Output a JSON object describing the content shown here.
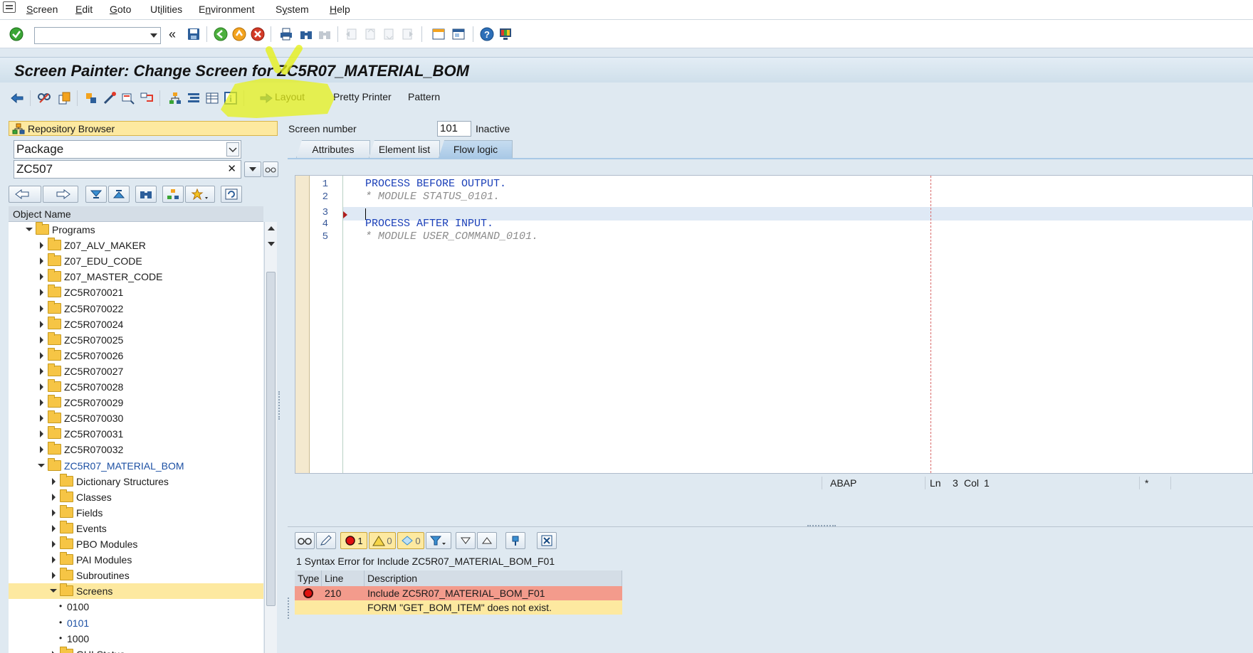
{
  "menu": [
    "Screen",
    "Edit",
    "Goto",
    "Utilities",
    "Environment",
    "System",
    "Help"
  ],
  "menu_underline": [
    "S",
    "E",
    "G",
    "i",
    "n",
    "y",
    "H"
  ],
  "window": {
    "title": "Screen Painter: Change Screen for ZC5R07_MATERIAL_BOM"
  },
  "command_field": {
    "value": ""
  },
  "app_toolbar": {
    "layout": "Layout",
    "pretty_printer": "Pretty Printer",
    "pattern": "Pattern"
  },
  "repository": {
    "header": "Repository Browser",
    "object_type": "Package",
    "object_name": "ZC507",
    "clear_symbol": "✕",
    "column": "Object Name"
  },
  "tree": [
    {
      "label": "Programs",
      "level": 1,
      "expanded": true,
      "folder": true
    },
    {
      "label": "Z07_ALV_MAKER",
      "level": 2,
      "expanded": false,
      "folder": true
    },
    {
      "label": "Z07_EDU_CODE",
      "level": 2,
      "expanded": false,
      "folder": true
    },
    {
      "label": "Z07_MASTER_CODE",
      "level": 2,
      "expanded": false,
      "folder": true
    },
    {
      "label": "ZC5R070021",
      "level": 2,
      "expanded": false,
      "folder": true
    },
    {
      "label": "ZC5R070022",
      "level": 2,
      "expanded": false,
      "folder": true
    },
    {
      "label": "ZC5R070024",
      "level": 2,
      "expanded": false,
      "folder": true
    },
    {
      "label": "ZC5R070025",
      "level": 2,
      "expanded": false,
      "folder": true
    },
    {
      "label": "ZC5R070026",
      "level": 2,
      "expanded": false,
      "folder": true
    },
    {
      "label": "ZC5R070027",
      "level": 2,
      "expanded": false,
      "folder": true
    },
    {
      "label": "ZC5R070028",
      "level": 2,
      "expanded": false,
      "folder": true
    },
    {
      "label": "ZC5R070029",
      "level": 2,
      "expanded": false,
      "folder": true
    },
    {
      "label": "ZC5R070030",
      "level": 2,
      "expanded": false,
      "folder": true
    },
    {
      "label": "ZC5R070031",
      "level": 2,
      "expanded": false,
      "folder": true
    },
    {
      "label": "ZC5R070032",
      "level": 2,
      "expanded": false,
      "folder": true
    },
    {
      "label": "ZC5R07_MATERIAL_BOM",
      "level": 2,
      "expanded": true,
      "folder": true,
      "blue": true
    },
    {
      "label": "Dictionary Structures",
      "level": 3,
      "expanded": false,
      "folder": true
    },
    {
      "label": "Classes",
      "level": 3,
      "expanded": false,
      "folder": true
    },
    {
      "label": "Fields",
      "level": 3,
      "expanded": false,
      "folder": true
    },
    {
      "label": "Events",
      "level": 3,
      "expanded": false,
      "folder": true
    },
    {
      "label": "PBO Modules",
      "level": 3,
      "expanded": false,
      "folder": true
    },
    {
      "label": "PAI Modules",
      "level": 3,
      "expanded": false,
      "folder": true
    },
    {
      "label": "Subroutines",
      "level": 3,
      "expanded": false,
      "folder": true
    },
    {
      "label": "Screens",
      "level": 3,
      "expanded": true,
      "folder": true,
      "highlight": true
    },
    {
      "label": "0100",
      "level": 4,
      "bullet": true
    },
    {
      "label": "0101",
      "level": 4,
      "bullet": true,
      "blue": true
    },
    {
      "label": "1000",
      "level": 4,
      "bullet": true
    },
    {
      "label": "GUI Status",
      "level": 3,
      "expanded": false,
      "folder": true
    }
  ],
  "screen": {
    "number_label": "Screen number",
    "number": "101",
    "status": "Inactive"
  },
  "tabs": [
    {
      "label": "Attributes",
      "active": false
    },
    {
      "label": "Element list",
      "active": false
    },
    {
      "label": "Flow logic",
      "active": true
    }
  ],
  "editor": {
    "lines": [
      {
        "num": "1",
        "text": "PROCESS BEFORE OUTPUT.",
        "type": "kw"
      },
      {
        "num": "2",
        "text": "* MODULE STATUS_0101.",
        "type": "cm"
      },
      {
        "num": "3",
        "text": "",
        "type": "kw"
      },
      {
        "num": "4",
        "text": "PROCESS AFTER INPUT.",
        "type": "kw"
      },
      {
        "num": "5",
        "text": "* MODULE USER_COMMAND_0101.",
        "type": "cm"
      }
    ],
    "status": {
      "lang": "ABAP",
      "ln_label": "Ln",
      "ln": "3",
      "col_label": "Col",
      "col": "1",
      "modified": "*"
    }
  },
  "errors": {
    "counts": {
      "error": "1",
      "warning": "0",
      "info": "0"
    },
    "message": "1 Syntax Error for Include ZC5R07_MATERIAL_BOM_F01",
    "columns": [
      "Type",
      "Line",
      "Description"
    ],
    "rows": [
      {
        "line": "210",
        "description": "Include ZC5R07_MATERIAL_BOM_F01",
        "style": "red"
      },
      {
        "line": "",
        "description": "FORM \"GET_BOM_ITEM\" does not exist.",
        "style": "yellow"
      }
    ]
  },
  "colors": {
    "background": "#dfe9f1",
    "keyword": "#1a3fb8",
    "comment": "#8c8c8c",
    "error_row": "#f39b8c",
    "message_row": "#fde9a0",
    "highlighter": "#e6f01a"
  }
}
